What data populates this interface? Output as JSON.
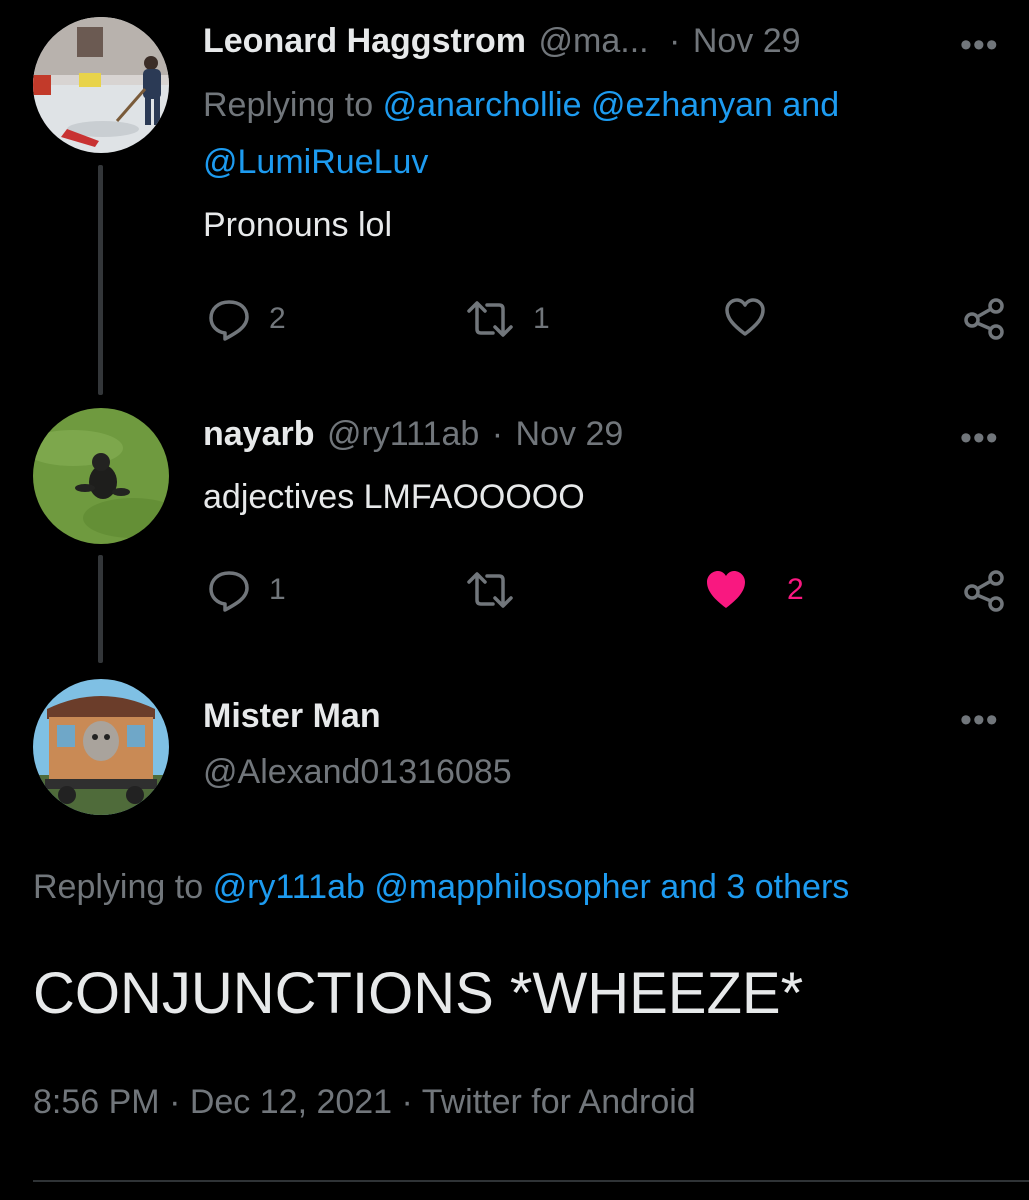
{
  "tweets": [
    {
      "name": "Leonard Haggstrom",
      "handle": "@ma...",
      "dot": "·",
      "date": "Nov 29",
      "replying_prefix": "Replying to",
      "replying_line1": "@anarchollie @ezhanyan and",
      "replying_line2": "@LumiRueLuv",
      "text": "Pronouns lol",
      "reply_count": "2",
      "retweet_count": "1",
      "like_count": "",
      "liked": false
    },
    {
      "name": "nayarb",
      "handle": "@ry111ab",
      "dot": "·",
      "date": "Nov 29",
      "text": "adjectives LMFAOOOOO",
      "reply_count": "1",
      "retweet_count": "",
      "like_count": "2",
      "liked": true
    }
  ],
  "main": {
    "name": "Mister Man",
    "handle": "@Alexand01316085",
    "replying_prefix": "Replying to",
    "replying_mentions": "@ry111ab @mapphilosopher and 3 others",
    "text": "CONJUNCTIONS  *WHEEZE*",
    "timestamp": "8:56 PM · Dec 12, 2021 · Twitter for Android"
  },
  "more_label": "•••",
  "icons": {
    "reply": "reply-icon",
    "retweet": "retweet-icon",
    "like": "heart-icon",
    "share": "share-icon",
    "more": "more-icon"
  },
  "colors": {
    "background": "#000000",
    "text": "#e7e9ea",
    "muted": "#71767b",
    "link": "#1d9bf0",
    "like": "#f91880"
  }
}
